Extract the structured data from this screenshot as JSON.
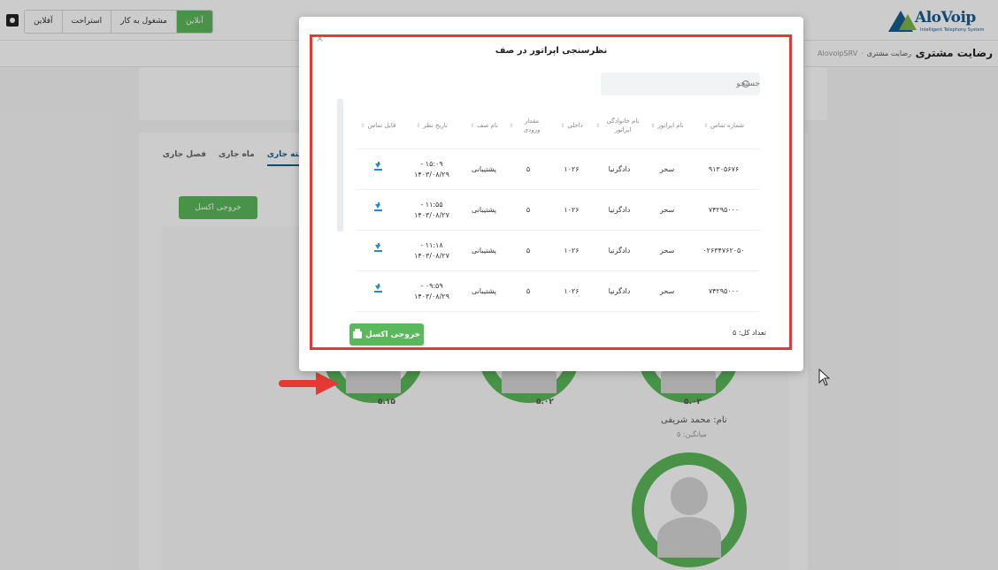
{
  "topbar": {
    "status_online": "آنلاین",
    "status_busy": "مشغول به کار",
    "status_break": "استراحت",
    "status_offline": "آفلاین",
    "logo_text": "AloVoip",
    "logo_subtitle": "Intelligent Telephony System"
  },
  "header": {
    "page_title": "رضایت مشتری",
    "breadcrumb": [
      "AlovoipSRV",
      "رضایت مشتری"
    ]
  },
  "background": {
    "tabs": [
      "هفته جاری",
      "ماه جاری",
      "فصل جاری"
    ],
    "excel_button": "خروجی اکسل",
    "scores": [
      "۵.۱۵",
      "۵.۰۲",
      "۵.۰۲"
    ],
    "agent_name": "نام: محمد شریفی",
    "agent_avg": "میانگین: ۵"
  },
  "modal": {
    "title": "نظرسنجی اپراتور در صف",
    "search_placeholder": "جستجو",
    "columns": [
      "شماره تماس",
      "نام اپراتور",
      "نام خانوادگی اپراتور",
      "داخلی",
      "مقدار ورودی",
      "نام صف",
      "تاریخ نظر",
      "فایل تماس"
    ],
    "rows": [
      {
        "phone": "۹۱۳۰۵۶۷۶",
        "first_name": "سحر",
        "last_name": "دادگرنیا",
        "ext": "۱۰۲۶",
        "value": "۵",
        "queue": "پشتیبانی",
        "time": "۱۵:۰۹ -",
        "date": "۱۴۰۳/۰۸/۲۹"
      },
      {
        "phone": "۷۴۲۹۵۰۰۰",
        "first_name": "سحر",
        "last_name": "دادگرنیا",
        "ext": "۱۰۲۶",
        "value": "۵",
        "queue": "پشتیبانی",
        "time": "۱۱:۵۵ -",
        "date": "۱۴۰۳/۰۸/۲۷"
      },
      {
        "phone": "۰۲۶۳۴۷۶۲۰۵۰",
        "first_name": "سحر",
        "last_name": "دادگرنیا",
        "ext": "۱۰۲۶",
        "value": "۵",
        "queue": "پشتیبانی",
        "time": "۱۱:۱۸ -",
        "date": "۱۴۰۳/۰۸/۲۷"
      },
      {
        "phone": "۷۴۲۹۵۰۰۰",
        "first_name": "سحر",
        "last_name": "دادگرنیا",
        "ext": "۱۰۲۶",
        "value": "۵",
        "queue": "پشتیبانی",
        "time": "۰۹:۵۹ -",
        "date": "۱۴۰۳/۰۸/۲۹"
      }
    ],
    "excel_button": "خروجی اکسل",
    "total": "تعداد کل: ۵",
    "close": "×"
  },
  "colors": {
    "accent_green": "#5cb85c",
    "brand_blue": "#1a5d8e",
    "highlight_red": "#e53935",
    "download_blue": "#1e88e5"
  }
}
